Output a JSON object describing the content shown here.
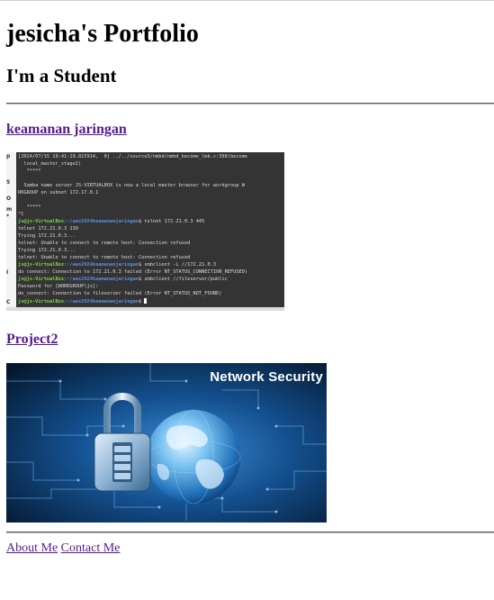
{
  "header": {
    "title": "jesicha's Portfolio",
    "subtitle": "I'm a Student"
  },
  "projects": [
    {
      "link_text": "keamanan jaringan",
      "image_kind": "terminal-screenshot",
      "terminal": {
        "gutter_letters": [
          "p",
          "5",
          "O",
          "m",
          "*",
          "I",
          "C"
        ],
        "lines": [
          {
            "text": "[2024/07/15 19:41:19.815914,  0] ../../source3/nmbd/nmbd_become_lmb.c:398(become"
          },
          {
            "text": "  local_master_stage2)"
          },
          {
            "text": "   *****"
          },
          {
            "text": ""
          },
          {
            "text": "  Samba name server JS-VIRTUALBOX is now a local master browser for workgroup W"
          },
          {
            "text": "RKGROUP on subnet 172.17.0.1"
          },
          {
            "text": ""
          },
          {
            "text": "   *****"
          },
          {
            "text": "^C"
          },
          {
            "prompt": "js@js-VirtualBox",
            "path": ":~/aas2024keamananjaringan",
            "cmd": "$ telnet 172.21.0.3 445"
          },
          {
            "text": "telnet 172.21.0.3 139"
          },
          {
            "text": "Trying 172.21.0.3..."
          },
          {
            "text": "telnet: Unable to connect to remote host: Connection refused"
          },
          {
            "text": "Trying 172.21.0.3..."
          },
          {
            "text": "telnet: Unable to connect to remote host: Connection refused"
          },
          {
            "prompt": "js@js-VirtualBox",
            "path": ":~/aas2024keamananjaringan",
            "cmd": "$ smbclient -L //172.21.0.3"
          },
          {
            "text": "do connect: Connection to 172.21.0.3 failed (Error NT_STATUS_CONNECTION_REFUSED)"
          },
          {
            "prompt": "js@js-VirtualBox",
            "path": ":~/aas2024keamananjaringan",
            "cmd": "$ smbclient //fileserver/public"
          },
          {
            "text": "Password for [WORKGROUP\\js]:"
          },
          {
            "text": "do_connect: Connection to fileserver failed (Error NT_STATUS_NOT_FOUND)"
          },
          {
            "prompt": "js@js-VirtualBox",
            "path": ":~/aas2024keamananjaringan",
            "cmd": "$ ",
            "cursor": true
          }
        ]
      }
    },
    {
      "link_text": "Project2",
      "image_kind": "network-security-banner",
      "banner_text": "Network Security"
    }
  ],
  "footer": {
    "links": [
      "About Me",
      "Contact Me"
    ]
  },
  "colors": {
    "link_visited": "#551a8b",
    "terminal_bg": "#343434",
    "prompt_green": "#7fd24b",
    "path_blue": "#5a8fe0",
    "banner_bg": "#0b2a4a"
  }
}
